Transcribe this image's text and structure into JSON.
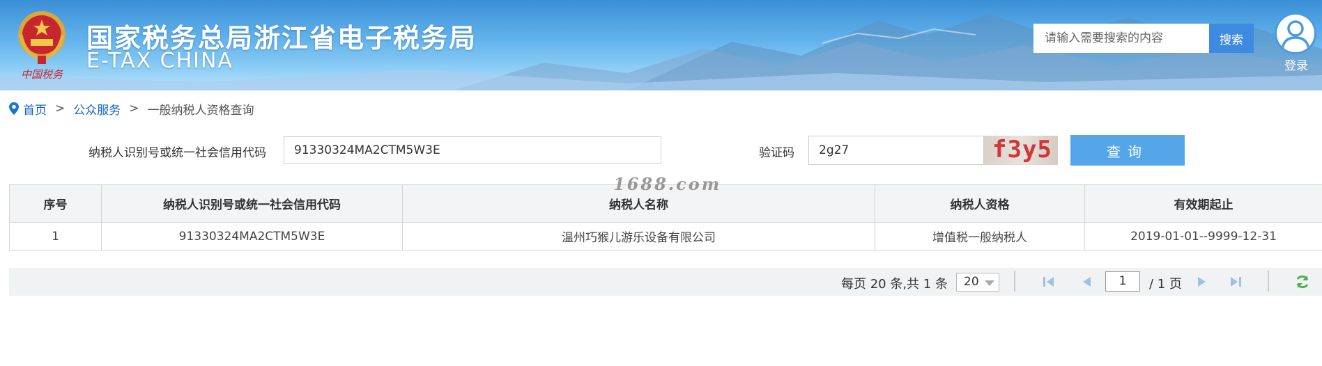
{
  "header": {
    "title": "国家税务总局浙江省电子税务局",
    "subtitle": "E-TAX CHINA",
    "emblem_caption": "中国税务",
    "search_placeholder": "请输入需要搜索的内容",
    "search_button": "搜索",
    "login_label": "登录"
  },
  "breadcrumb": {
    "home": "首页",
    "sep": ">",
    "section": "公众服务",
    "current": "一般纳税人资格查询"
  },
  "form": {
    "taxpayer_id_label": "纳税人识别号或统一社会信用代码",
    "taxpayer_id_value": "91330324MA2CTM5W3E",
    "captcha_label": "验证码",
    "captcha_value": "2g27",
    "captcha_image_text": "f3y5",
    "query_button": "查询"
  },
  "watermark": "1688.com",
  "table": {
    "headers": [
      "序号",
      "纳税人识别号或统一社会信用代码",
      "纳税人名称",
      "纳税人资格",
      "有效期起止"
    ],
    "rows": [
      [
        "1",
        "91330324MA2CTM5W3E",
        "温州巧猴儿游乐设备有限公司",
        "增值税一般纳税人",
        "2019-01-01--9999-12-31"
      ]
    ]
  },
  "pagination": {
    "info": "每页 20 条,共 1 条",
    "page_size": "20",
    "current_page": "1",
    "total_pages": "/ 1 页"
  },
  "colors": {
    "accent": "#55a6e8",
    "link": "#1565c0",
    "search_button": "#3d8ae0",
    "captcha_text": "#d2343a"
  }
}
